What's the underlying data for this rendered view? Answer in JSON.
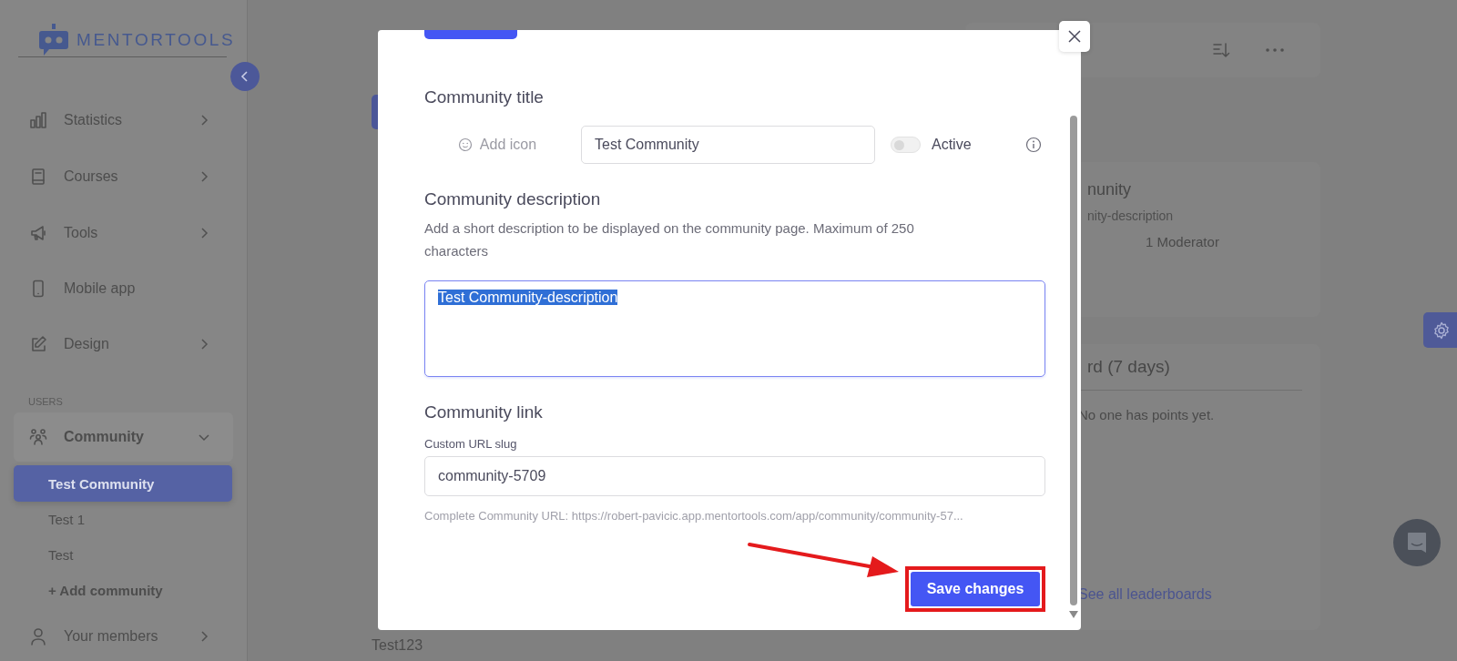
{
  "sidebar": {
    "logo_text": "MENTORTOOLS",
    "items": [
      {
        "kind": "nav",
        "label": "Statistics",
        "expanded": false
      },
      {
        "kind": "nav",
        "label": "Courses",
        "expanded": false
      },
      {
        "kind": "nav",
        "label": "Tools",
        "expanded": false
      },
      {
        "kind": "link",
        "label": "Mobile app"
      },
      {
        "kind": "nav",
        "label": "Design",
        "expanded": false
      },
      {
        "kind": "section",
        "label": "USERS"
      },
      {
        "kind": "nav",
        "label": "Community",
        "expanded": true,
        "children": [
          {
            "kind": "child",
            "label": "Test Community",
            "selected": true
          },
          {
            "kind": "child",
            "label": "Test 1",
            "selected": false
          },
          {
            "kind": "child",
            "label": "Test",
            "selected": false
          },
          {
            "kind": "add",
            "label": "+ Add community",
            "selected": false
          }
        ]
      },
      {
        "kind": "nav",
        "label": "Your members",
        "expanded": false
      }
    ]
  },
  "background": {
    "left_card_title": "Test123",
    "community_card": {
      "title": "nunity",
      "description": "nity-description",
      "moderators": "1 Moderator"
    },
    "leaderboard": {
      "title": "rd (7 days)",
      "empty_message": "No one has points yet.",
      "link": "See all leaderboards"
    }
  },
  "modal": {
    "title_section": {
      "heading": "Community title",
      "add_icon_label": "Add icon",
      "title_value": "Test Community",
      "active_label": "Active",
      "active": false
    },
    "description_section": {
      "heading": "Community description",
      "help": "Add a short description to be displayed on the community page. Maximum of 250 characters",
      "value": "Test Community-description",
      "text_selected": true
    },
    "link_section": {
      "heading": "Community link",
      "slug_label": "Custom URL slug",
      "slug_value": "community-5709",
      "complete_url": "Complete Community URL: https://robert-pavicic.app.mentortools.com/app/community/community-57..."
    },
    "save_button": "Save changes"
  }
}
